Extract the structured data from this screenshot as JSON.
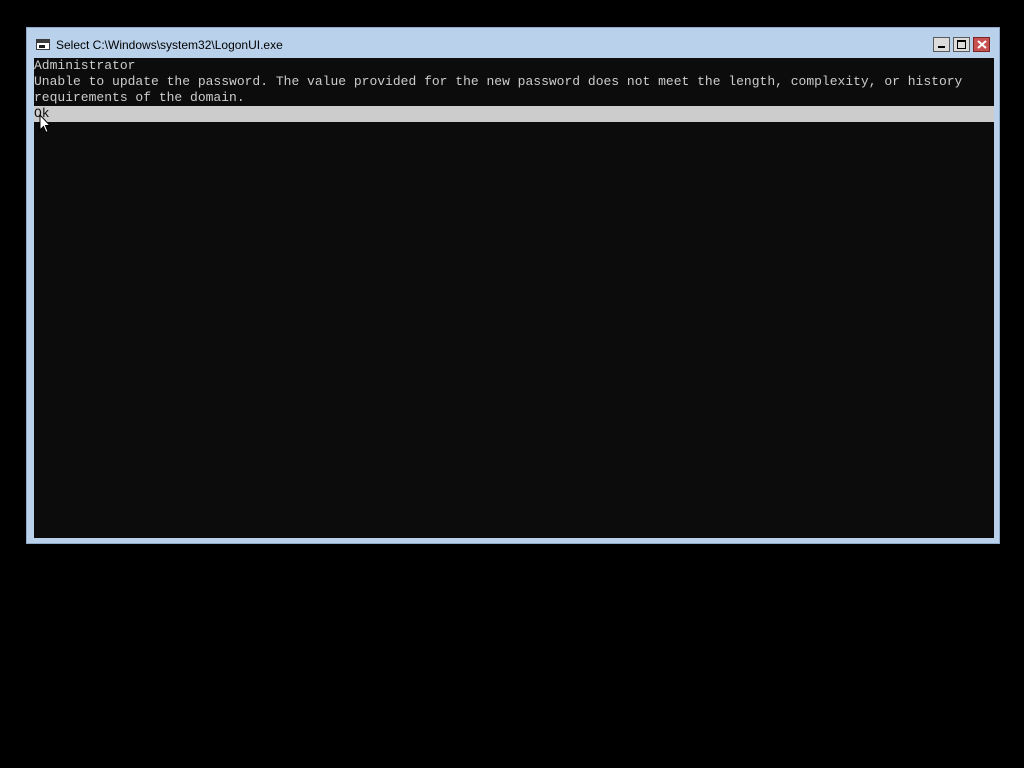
{
  "window": {
    "title": "Select C:\\Windows\\system32\\LogonUI.exe",
    "icon": "console-app-icon",
    "controls": [
      "minimize",
      "maximize",
      "close"
    ]
  },
  "console": {
    "lines": [
      "Administrator",
      "Unable to update the password. The value provided for the new password does not meet the length, complexity, or history",
      "requirements of the domain."
    ],
    "selected_option": "Ok"
  },
  "colors": {
    "console_background": "#0c0c0c",
    "console_text": "#cccccc",
    "selection_background": "#cccccc",
    "window_frame": "#b9d1ea",
    "close_button": "#c75050"
  }
}
